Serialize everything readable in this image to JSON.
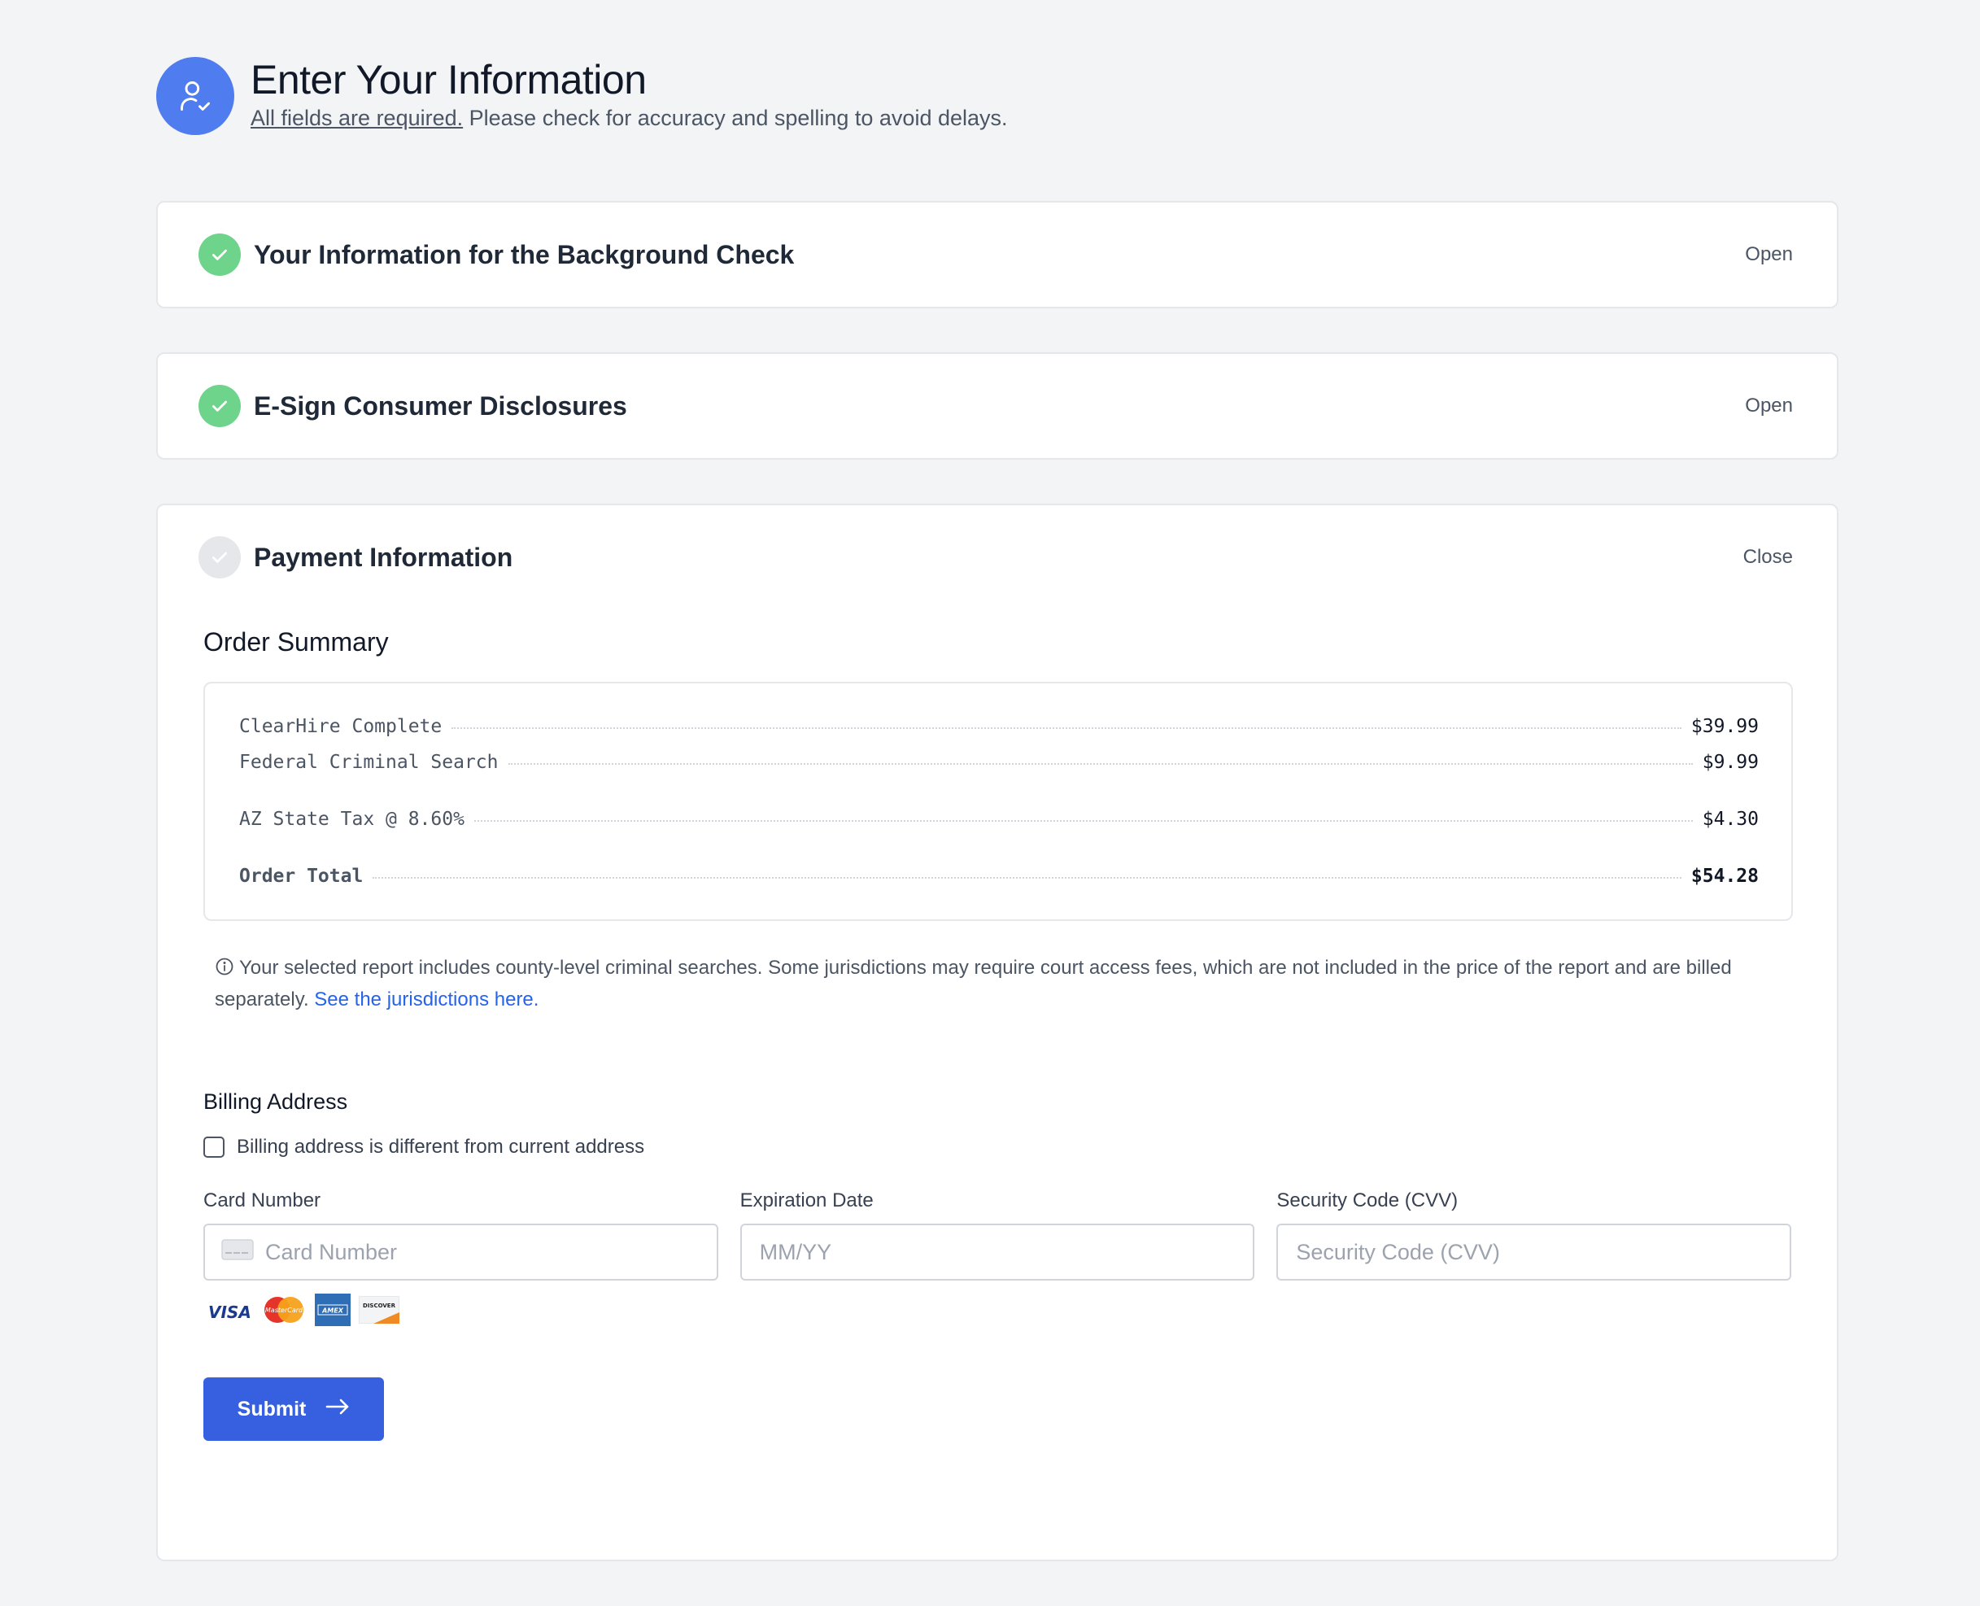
{
  "header": {
    "title": "Enter Your Information",
    "subtitle_underlined": "All fields are required.",
    "subtitle_rest": " Please check for accuracy and spelling to avoid delays.",
    "icon": "user-check-icon",
    "icon_bg": "#4f7df0"
  },
  "sections": [
    {
      "title": "Your Information for the Background Check",
      "status": "complete",
      "toggle": "Open"
    },
    {
      "title": "E-Sign Consumer Disclosures",
      "status": "complete",
      "toggle": "Open"
    },
    {
      "title": "Payment Information",
      "status": "incomplete",
      "toggle": "Close"
    }
  ],
  "order_summary": {
    "title": "Order Summary",
    "items": [
      {
        "label": "ClearHire Complete",
        "amount": "$39.99"
      },
      {
        "label": "Federal Criminal Search",
        "amount": "$9.99"
      }
    ],
    "tax": {
      "label": "AZ State Tax @ 8.60%",
      "amount": "$4.30"
    },
    "total": {
      "label": "Order Total",
      "amount": "$54.28"
    }
  },
  "notice": {
    "text": "Your selected report includes county-level criminal searches. Some jurisdictions may require court access fees, which are not included in the price of the report and are billed separately. ",
    "link": "See the jurisdictions here."
  },
  "billing": {
    "title": "Billing Address",
    "checkbox_label": "Billing address is different from current address",
    "checkbox_checked": false
  },
  "payment_fields": {
    "card_number": {
      "label": "Card Number",
      "placeholder": "Card Number"
    },
    "expiration": {
      "label": "Expiration Date",
      "placeholder": "MM/YY"
    },
    "cvv": {
      "label": "Security Code (CVV)",
      "placeholder": "Security Code (CVV)"
    }
  },
  "card_brands": {
    "visa": "VISA",
    "mastercard": "MasterCard",
    "amex": "AMEX",
    "discover": "DISCOVER"
  },
  "submit_label": "Submit",
  "colors": {
    "accent": "#3660e0",
    "complete_green": "#6ed38b",
    "link": "#2563eb"
  }
}
